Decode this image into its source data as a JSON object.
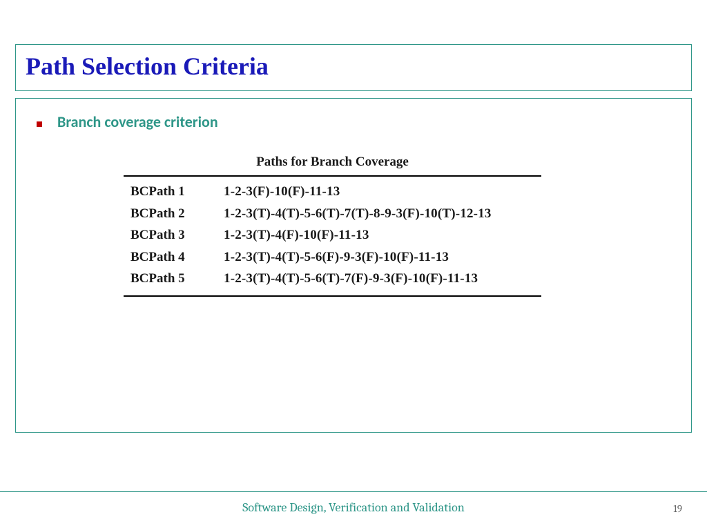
{
  "title": "Path Selection Criteria",
  "bullet": "Branch coverage criterion",
  "tableCaption": "Paths for Branch Coverage",
  "rows": [
    {
      "name": "BCPath 1",
      "value": "1-2-3(F)-10(F)-11-13"
    },
    {
      "name": "BCPath 2",
      "value": "1-2-3(T)-4(T)-5-6(T)-7(T)-8-9-3(F)-10(T)-12-13"
    },
    {
      "name": "BCPath 3",
      "value": "1-2-3(T)-4(F)-10(F)-11-13"
    },
    {
      "name": "BCPath 4",
      "value": "1-2-3(T)-4(T)-5-6(F)-9-3(F)-10(F)-11-13"
    },
    {
      "name": "BCPath 5",
      "value": "1-2-3(T)-4(T)-5-6(T)-7(F)-9-3(F)-10(F)-11-13"
    }
  ],
  "footer": "Software Design,  Verification and Validation",
  "pageNumber": "19"
}
